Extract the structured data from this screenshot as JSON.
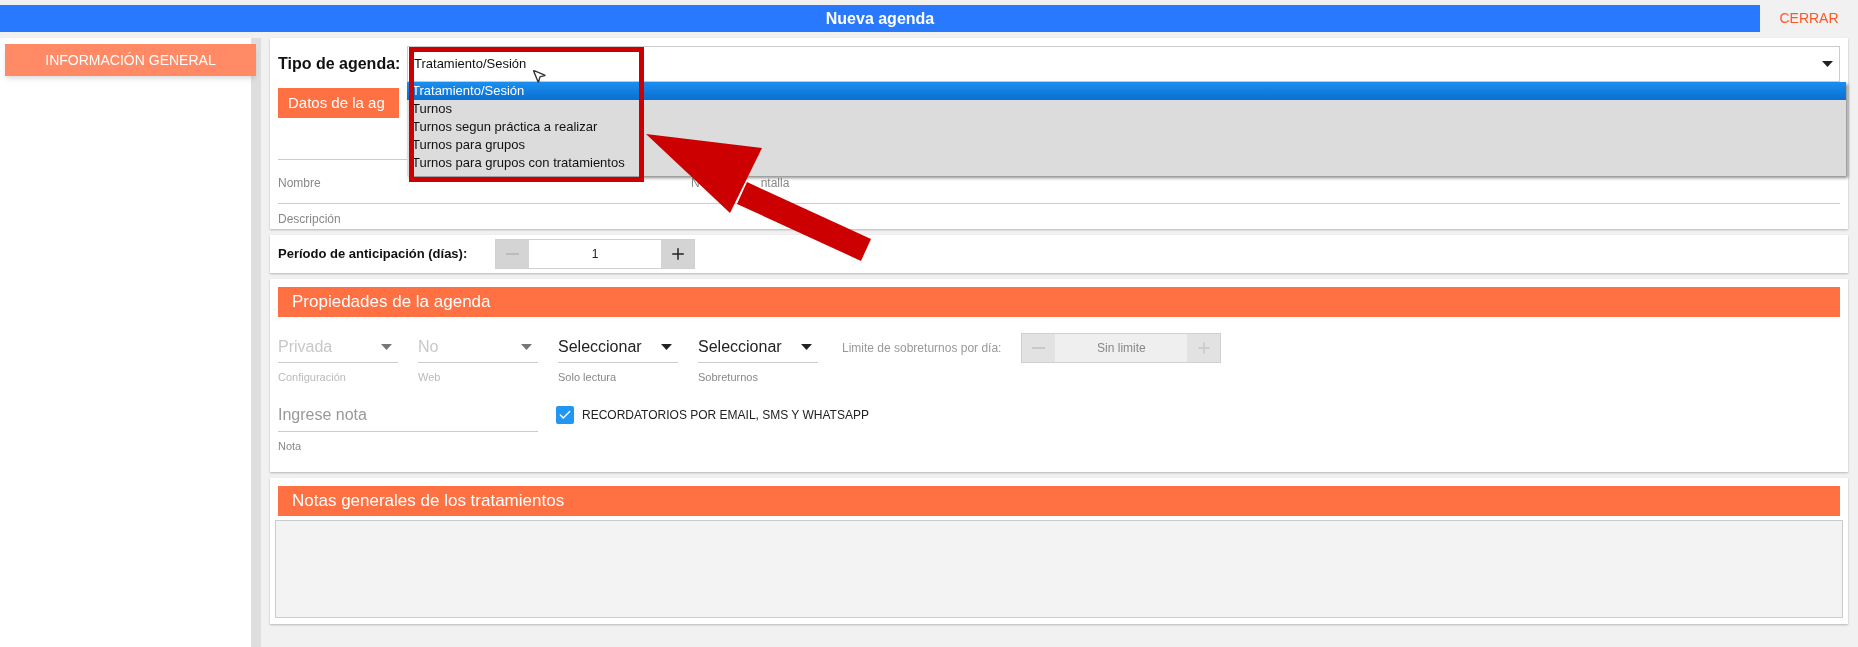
{
  "header": {
    "title": "Nueva agenda",
    "close": "CERRAR"
  },
  "sidebar": {
    "items": [
      {
        "label": "INFORMACIÓN GENERAL",
        "selected": true
      }
    ]
  },
  "tipo_agenda": {
    "label": "Tipo de agenda:",
    "value": "Tratamiento/Sesión",
    "expanded": true,
    "options": [
      {
        "label": "Tratamiento/Sesión",
        "selected": true
      },
      {
        "label": "Turnos",
        "selected": false
      },
      {
        "label": "Turnos segun práctica a realizar",
        "selected": false
      },
      {
        "label": "Turnos para grupos",
        "selected": false
      },
      {
        "label": "Turnos para grupos con tratamientos",
        "selected": false
      }
    ]
  },
  "datos": {
    "header": "Datos de la ag",
    "fields": [
      {
        "label": "Nombre"
      },
      {
        "label_parts": [
          "N",
          "ntalla"
        ]
      },
      {
        "label": "Descripción"
      }
    ]
  },
  "anticipacion": {
    "label": "Período de anticipación (días):",
    "value": "1",
    "disabled": false
  },
  "propiedades": {
    "header": "Propiedades de la agenda",
    "selects": [
      {
        "value": "Privada",
        "label": "Configuración",
        "disabled": true
      },
      {
        "value": "No",
        "label": "Web",
        "disabled": true
      },
      {
        "value": "Seleccionar",
        "label": "Solo lectura",
        "disabled": false
      },
      {
        "value": "Seleccionar",
        "label": "Sobreturnos",
        "disabled": false
      }
    ],
    "limite": {
      "label": "Limite de sobreturnos por día:",
      "value": "Sin limite",
      "disabled": true
    },
    "nota": {
      "placeholder": "Ingrese nota",
      "label": "Nota"
    },
    "recordatorios": {
      "label": "RECORDATORIOS POR EMAIL, SMS Y WHATSAPP",
      "checked": true
    }
  },
  "notas": {
    "header": "Notas generales de los tratamientos"
  }
}
